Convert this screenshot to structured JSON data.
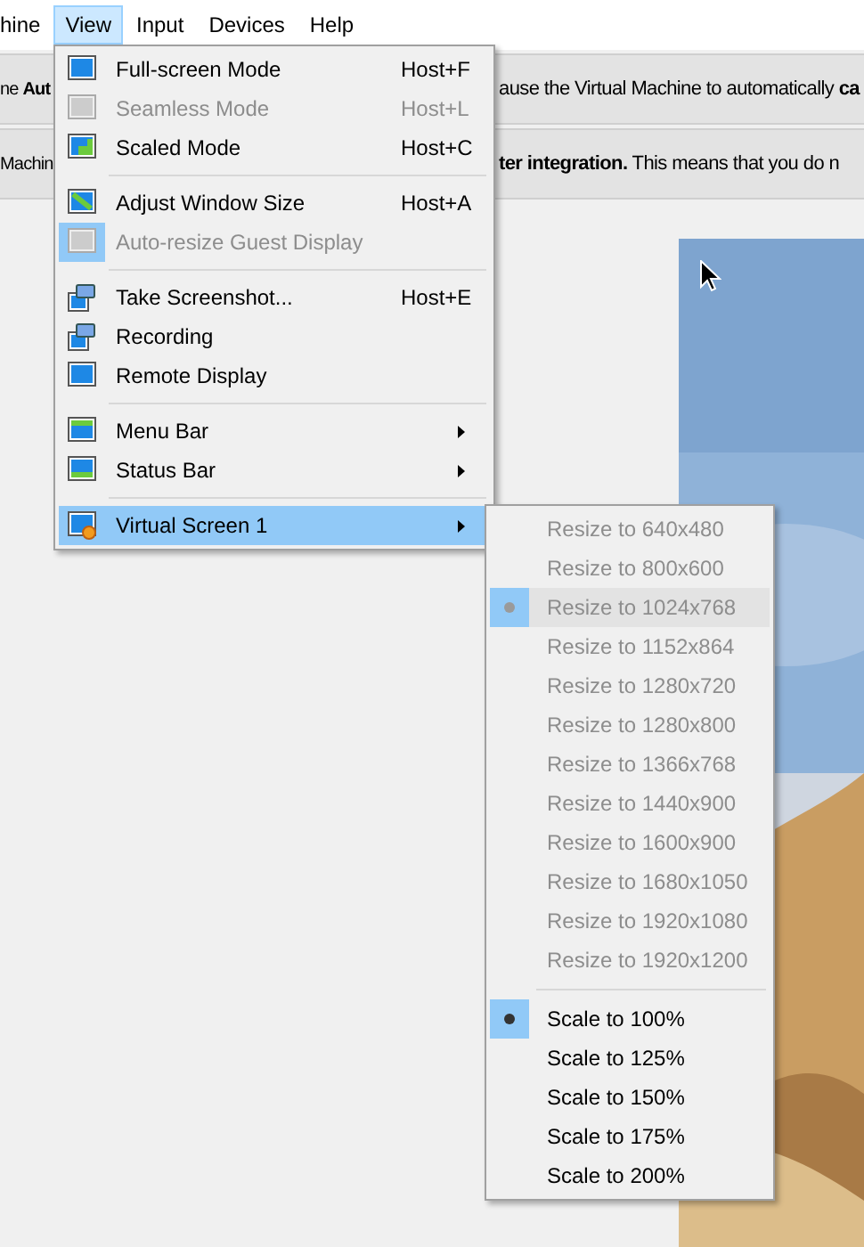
{
  "menu_bar": [
    {
      "label": "hine",
      "selected": false
    },
    {
      "label": "View",
      "selected": true
    },
    {
      "label": "Input",
      "selected": false
    },
    {
      "label": "Devices",
      "selected": false
    },
    {
      "label": "Help",
      "selected": false
    }
  ],
  "notices": [
    {
      "left": "ne **Aut**",
      "right": "ause the Virtual Machine to automatically **ca**"
    },
    {
      "left": "Machin",
      "right": "**ter integration.** This means that you do n"
    }
  ],
  "view_menu": [
    {
      "kind": "item",
      "label": "Full-screen Mode",
      "shortcut": "Host+F",
      "disabled": false,
      "checked": false,
      "submenu": false,
      "selected": false
    },
    {
      "kind": "item",
      "label": "Seamless Mode",
      "shortcut": "Host+L",
      "disabled": true,
      "checked": false,
      "submenu": false,
      "selected": false
    },
    {
      "kind": "item",
      "label": "Scaled Mode",
      "shortcut": "Host+C",
      "disabled": false,
      "checked": false,
      "submenu": false,
      "selected": false
    },
    {
      "kind": "separator"
    },
    {
      "kind": "item",
      "label": "Adjust Window Size",
      "shortcut": "Host+A",
      "disabled": false,
      "checked": false,
      "submenu": false,
      "selected": false
    },
    {
      "kind": "item",
      "label": "Auto-resize Guest Display",
      "disabled": true,
      "checked": true,
      "submenu": false,
      "selected": false
    },
    {
      "kind": "separator"
    },
    {
      "kind": "item",
      "label": "Take Screenshot...",
      "shortcut": "Host+E",
      "disabled": false,
      "checked": false,
      "submenu": false,
      "selected": false
    },
    {
      "kind": "item",
      "label": "Recording",
      "disabled": false,
      "checked": false,
      "submenu": false,
      "selected": false
    },
    {
      "kind": "item",
      "label": "Remote Display",
      "disabled": false,
      "checked": false,
      "submenu": false,
      "selected": false
    },
    {
      "kind": "separator"
    },
    {
      "kind": "item",
      "label": "Menu Bar",
      "disabled": false,
      "checked": false,
      "submenu": true,
      "selected": false
    },
    {
      "kind": "item",
      "label": "Status Bar",
      "disabled": false,
      "checked": false,
      "submenu": true,
      "selected": false
    },
    {
      "kind": "separator"
    },
    {
      "kind": "item",
      "label": "Virtual Screen 1",
      "disabled": false,
      "checked": false,
      "submenu": true,
      "selected": true
    }
  ],
  "screen_submenu": [
    {
      "kind": "item",
      "label": "Resize to 640x480",
      "disabled": true,
      "checked": false,
      "hovered": false
    },
    {
      "kind": "item",
      "label": "Resize to 800x600",
      "disabled": true,
      "checked": false,
      "hovered": false
    },
    {
      "kind": "item",
      "label": "Resize to 1024x768",
      "disabled": true,
      "checked": true,
      "hovered": true
    },
    {
      "kind": "item",
      "label": "Resize to 1152x864",
      "disabled": true,
      "checked": false,
      "hovered": false
    },
    {
      "kind": "item",
      "label": "Resize to 1280x720",
      "disabled": true,
      "checked": false,
      "hovered": false
    },
    {
      "kind": "item",
      "label": "Resize to 1280x800",
      "disabled": true,
      "checked": false,
      "hovered": false
    },
    {
      "kind": "item",
      "label": "Resize to 1366x768",
      "disabled": true,
      "checked": false,
      "hovered": false
    },
    {
      "kind": "item",
      "label": "Resize to 1440x900",
      "disabled": true,
      "checked": false,
      "hovered": false
    },
    {
      "kind": "item",
      "label": "Resize to 1600x900",
      "disabled": true,
      "checked": false,
      "hovered": false
    },
    {
      "kind": "item",
      "label": "Resize to 1680x1050",
      "disabled": true,
      "checked": false,
      "hovered": false
    },
    {
      "kind": "item",
      "label": "Resize to 1920x1080",
      "disabled": true,
      "checked": false,
      "hovered": false
    },
    {
      "kind": "item",
      "label": "Resize to 1920x1200",
      "disabled": true,
      "checked": false,
      "hovered": false
    },
    {
      "kind": "separator"
    },
    {
      "kind": "item",
      "label": "Scale to 100%",
      "disabled": false,
      "checked": true,
      "hovered": false
    },
    {
      "kind": "item",
      "label": "Scale to 125%",
      "disabled": false,
      "checked": false,
      "hovered": false
    },
    {
      "kind": "item",
      "label": "Scale to 150%",
      "disabled": false,
      "checked": false,
      "hovered": false
    },
    {
      "kind": "item",
      "label": "Scale to 175%",
      "disabled": false,
      "checked": false,
      "hovered": false
    },
    {
      "kind": "item",
      "label": "Scale to 200%",
      "disabled": false,
      "checked": false,
      "hovered": false
    }
  ]
}
